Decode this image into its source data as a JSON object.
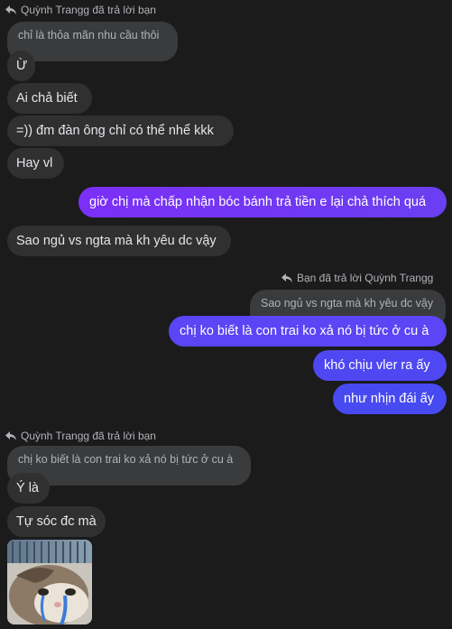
{
  "thread": {
    "group1": {
      "reply_header": "Quỳnh Trangg đã trả lời bạn",
      "quoted": "chỉ là thỏa mãn nhu cầu thôi",
      "messages": [
        "Ừ",
        "Ai chả biết",
        "=)) đm đàn ông chỉ có thể nhể kkk",
        "Hay vl"
      ]
    },
    "outgoing1": "giờ chị mà chấp nhận bóc bánh trả tiền e lại chả thích quá",
    "incoming2": "Sao ngủ vs ngta mà kh yêu dc vậy",
    "group2": {
      "reply_header": "Bạn đã trả lời Quỳnh Trangg",
      "quoted": "Sao ngủ vs ngta mà kh yêu dc vậy",
      "messages": [
        "chị ko biết là con trai ko xả nó bị tức ở cu à",
        "khó chịu vler ra ấy",
        "như nhịn đái ấy"
      ]
    },
    "group3": {
      "reply_header": "Quỳnh Trangg đã trả lời bạn",
      "quoted": "chị ko biết là con trai ko xả nó bị tức ở cu à",
      "messages": [
        "Ý là",
        "Tự sóc đc mà"
      ],
      "sticker_icon": "crying-cat-sticker"
    }
  },
  "colors": {
    "background": "#1b1b1c",
    "incoming_bubble": "#303030",
    "quoted_bubble": "#3a3b3c",
    "outgoing_gradient": [
      "#7b2ff7",
      "#4a4cf0"
    ]
  }
}
